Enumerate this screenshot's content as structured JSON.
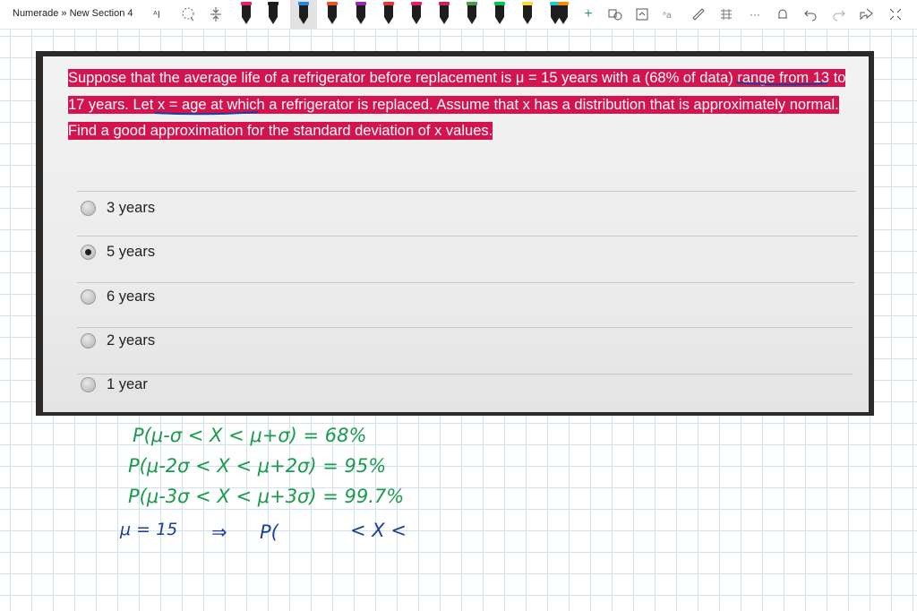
{
  "app": {
    "breadcrumb": "Numerade » New Section 4"
  },
  "toolbar": {
    "icons": [
      "text-ink-icon",
      "lasso-icon",
      "insert-space-icon",
      "pen-icons",
      "add-icon",
      "shapes-icon",
      "ink-to-shape-icon",
      "ink-to-text-icon",
      "ruler-icon",
      "math-icon",
      "more-icon",
      "replay-icon",
      "undo-icon",
      "redo-icon",
      "share-icon",
      "fullscreen-icon"
    ],
    "more_label": "···",
    "add_label": "+",
    "pen_colors": [
      "#1e1e1e",
      "#1e1e1e",
      "#1e1e1e",
      "#1e88e5",
      "#f4511e",
      "#9c27b0",
      "#e53935",
      "#e91e63",
      "#d81b60",
      "#43a047",
      "#00c853",
      "#fdd835",
      "#ab47bc",
      "#26c6da",
      "#fb8c00"
    ]
  },
  "question": {
    "text": "Suppose that the average life of a refrigerator before replacement is μ = 15 years with a (68% of data) range from 13 to 17 years. Let x = age at which a refrigerator is replaced. Assume that x has a distribution that is approximately normal. Find a good approximation for the standard deviation of x values.",
    "highlight_color": "#d4144e",
    "options": [
      {
        "label": "3 years",
        "selected": false
      },
      {
        "label": "5 years",
        "selected": true
      },
      {
        "label": "6 years",
        "selected": false
      },
      {
        "label": "2 years",
        "selected": false
      },
      {
        "label": "1 year",
        "selected": false
      }
    ]
  },
  "ink": {
    "line1": "P(μ-σ < X < μ+σ)  = 68%",
    "line2": "P(μ-2σ < X < μ+2σ)  = 95%",
    "line3": "P(μ-3σ < X < μ+3σ)  = 99.7%",
    "line4_a": "μ = 15",
    "line4_b": "⇒",
    "line4_c": "P(",
    "line4_d": "< X <",
    "green": "#1a9a4d",
    "blue": "#1b3f9e"
  }
}
